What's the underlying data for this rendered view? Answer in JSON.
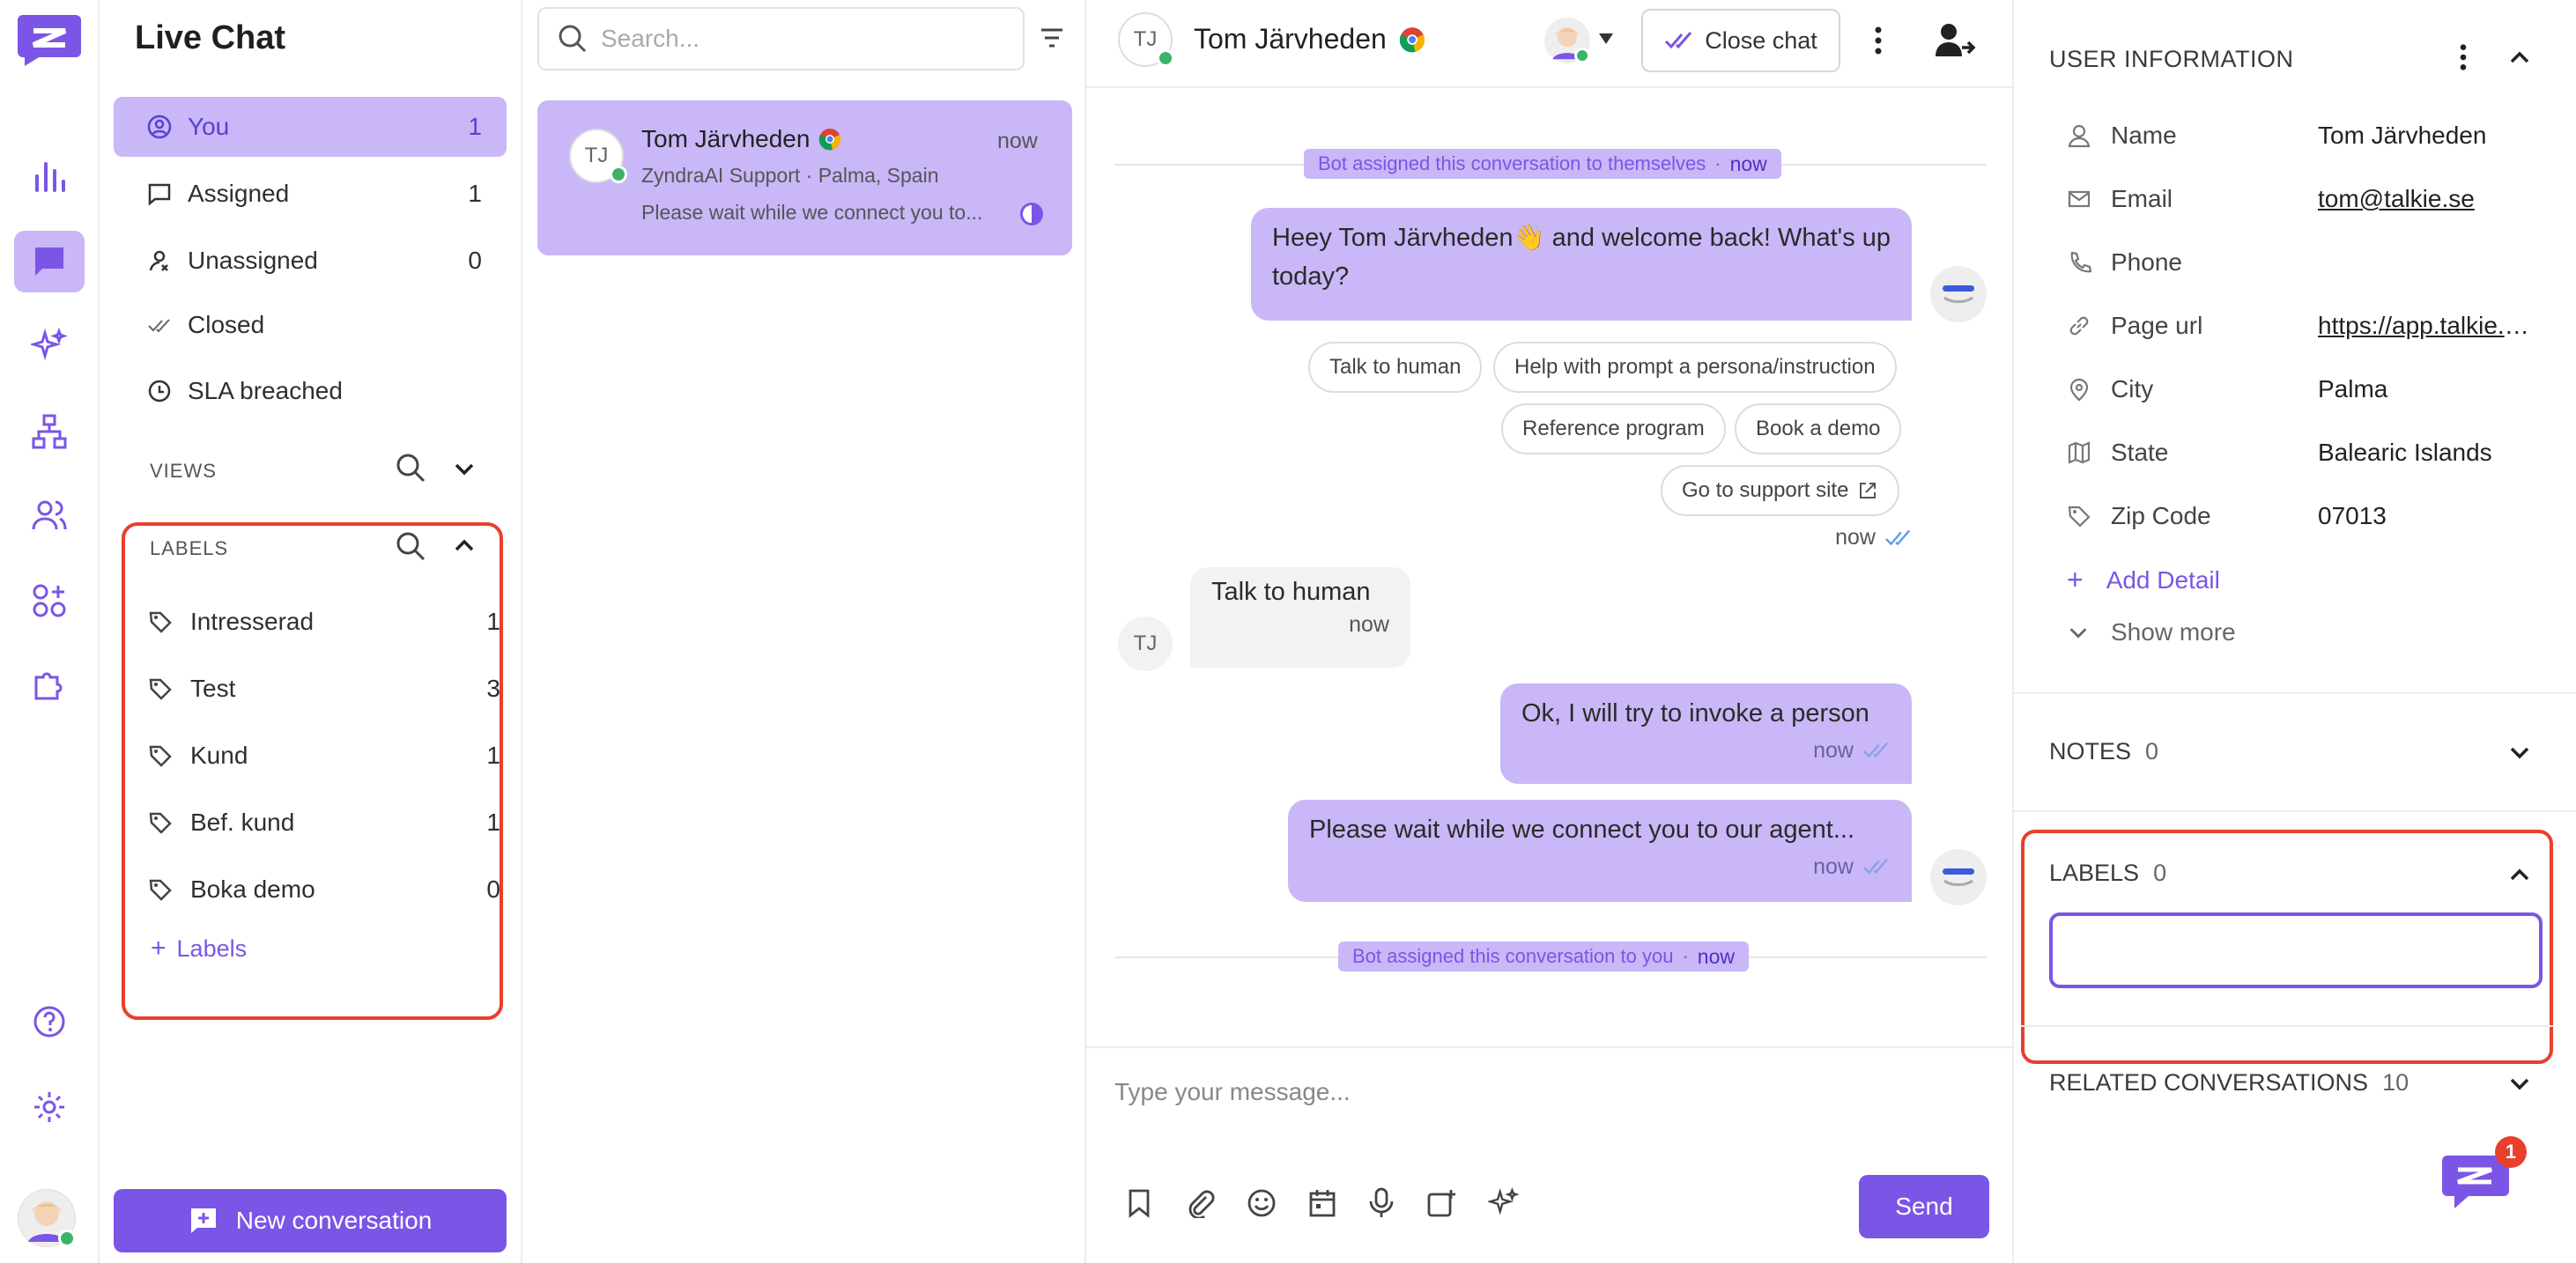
{
  "colors": {
    "accent": "#7b55e6",
    "accent_light": "#c9b7f7",
    "highlight": "#e8402d",
    "online": "#3db36a"
  },
  "rail": {
    "icons": [
      "logo-icon",
      "reports-icon",
      "chat-icon",
      "ai-icon",
      "flow-icon",
      "contacts-icon",
      "apps-icon",
      "integrations-icon",
      "help-icon",
      "settings-icon",
      "user-avatar"
    ],
    "active": "chat-icon"
  },
  "sidebar": {
    "title": "Live Chat",
    "items": [
      {
        "label": "You",
        "count": "1",
        "icon": "user-circle-icon"
      },
      {
        "label": "Assigned",
        "count": "1",
        "icon": "inbox-icon"
      },
      {
        "label": "Unassigned",
        "count": "0",
        "icon": "user-off-icon"
      },
      {
        "label": "Closed",
        "count": "",
        "icon": "double-check-icon"
      },
      {
        "label": "SLA breached",
        "count": "",
        "icon": "clock-icon"
      }
    ],
    "views_heading": "VIEWS",
    "labels_heading": "LABELS",
    "labels": [
      {
        "label": "Intresserad",
        "count": "1"
      },
      {
        "label": "Test",
        "count": "3"
      },
      {
        "label": "Kund",
        "count": "1"
      },
      {
        "label": "Bef. kund",
        "count": "1"
      },
      {
        "label": "Boka demo",
        "count": "0"
      }
    ],
    "add_label": "Labels",
    "new_conversation": "New conversation"
  },
  "convlist": {
    "search_placeholder": "Search...",
    "card": {
      "initials": "TJ",
      "name": "Tom Järvheden",
      "time": "now",
      "subtitle": "ZyndraAI Support · Palma, Spain",
      "preview": "Please wait while we connect you to..."
    }
  },
  "chat": {
    "initials": "TJ",
    "name": "Tom Järvheden",
    "close_label": "Close chat",
    "sys1_text": "Bot assigned this conversation to themselves",
    "sys1_time": "now",
    "msg1": "Heey Tom Järvheden👋 and welcome back! What's up today?",
    "quick_replies": [
      "Talk to human",
      "Help with prompt a persona/instruction",
      "Reference program",
      "Book a demo",
      "Go to support site"
    ],
    "qr_time": "now",
    "msg2_text": "Talk to human",
    "msg2_time": "now",
    "msg2_initials": "TJ",
    "msg3_text": "Ok, I will try to invoke a person",
    "msg3_time": "now",
    "msg4_text": "Please wait while we connect you to our agent...",
    "msg4_time": "now",
    "sys2_text": "Bot assigned this conversation to you",
    "sys2_time": "now",
    "composer_placeholder": "Type your message...",
    "send_label": "Send"
  },
  "info": {
    "heading": "USER INFORMATION",
    "rows": [
      {
        "key": "Name",
        "value": "Tom Järvheden",
        "icon": "person-icon"
      },
      {
        "key": "Email",
        "value": "tom@talkie.se",
        "icon": "mail-icon"
      },
      {
        "key": "Phone",
        "value": "",
        "icon": "phone-icon"
      },
      {
        "key": "Page url",
        "value": "https://app.talkie.se",
        "icon": "link-icon"
      },
      {
        "key": "City",
        "value": "Palma",
        "icon": "pin-icon"
      },
      {
        "key": "State",
        "value": "Balearic Islands",
        "icon": "map-icon"
      },
      {
        "key": "Zip Code",
        "value": "07013",
        "icon": "tag-icon"
      }
    ],
    "add_detail": "Add Detail",
    "show_more": "Show more",
    "notes_label": "NOTES",
    "notes_count": "0",
    "labels_label": "LABELS",
    "labels_count": "0",
    "related_label": "RELATED CONVERSATIONS",
    "related_count": "10",
    "widget_badge": "1"
  }
}
